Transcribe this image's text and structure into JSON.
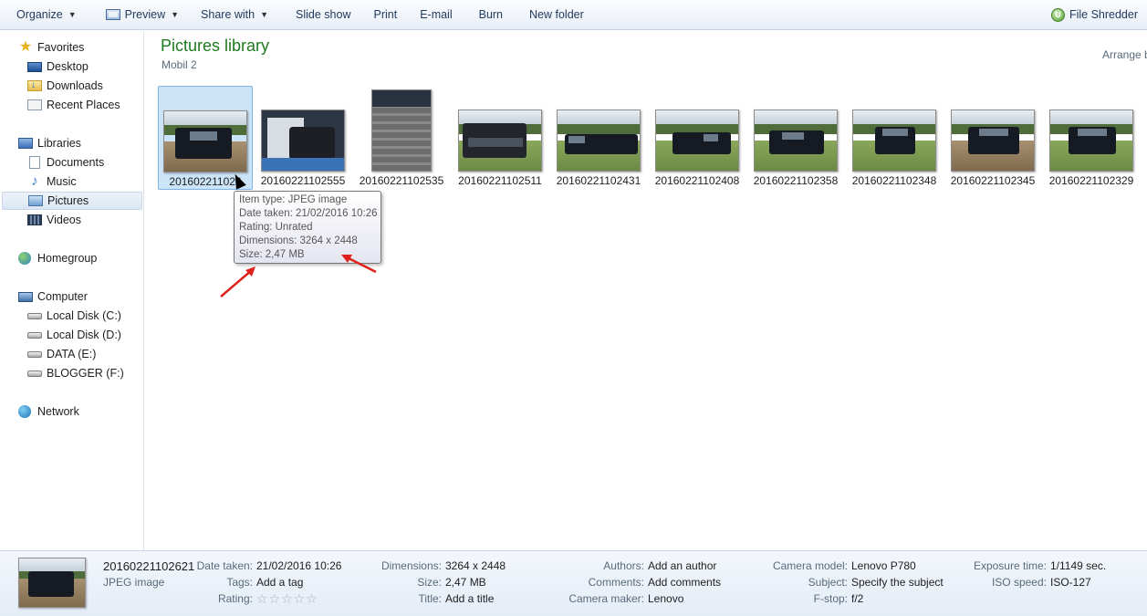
{
  "toolbar": {
    "organize": "Organize",
    "preview": "Preview",
    "share_with": "Share with",
    "slide_show": "Slide show",
    "print": "Print",
    "email": "E-mail",
    "burn": "Burn",
    "new_folder": "New folder",
    "file_shredder": "File Shredder",
    "file_shredder_icon_letter": "U"
  },
  "nav": {
    "favorites": "Favorites",
    "desktop": "Desktop",
    "downloads": "Downloads",
    "recent_places": "Recent Places",
    "libraries": "Libraries",
    "documents": "Documents",
    "music": "Music",
    "pictures": "Pictures",
    "videos": "Videos",
    "homegroup": "Homegroup",
    "computer": "Computer",
    "disk_c": "Local Disk (C:)",
    "disk_d": "Local Disk (D:)",
    "disk_e": "DATA (E:)",
    "disk_f": "BLOGGER (F:)",
    "network": "Network"
  },
  "header": {
    "title": "Pictures library",
    "subtitle": "Mobil 2",
    "arrange": "Arrange b"
  },
  "files": [
    {
      "name": "20160221102621",
      "label": "201602211026"
    },
    {
      "name": "20160221102555",
      "label": "20160221102555"
    },
    {
      "name": "20160221102535",
      "label": "20160221102535"
    },
    {
      "name": "20160221102511",
      "label": "20160221102511"
    },
    {
      "name": "20160221102431",
      "label": "20160221102431"
    },
    {
      "name": "20160221102408",
      "label": "20160221102408"
    },
    {
      "name": "20160221102358",
      "label": "20160221102358"
    },
    {
      "name": "20160221102348",
      "label": "20160221102348"
    },
    {
      "name": "20160221102345",
      "label": "20160221102345"
    },
    {
      "name": "20160221102329",
      "label": "20160221102329"
    }
  ],
  "tooltip": {
    "item_type": "Item type: JPEG image",
    "date_taken": "Date taken: 21/02/2016 10:26",
    "rating": "Rating: Unrated",
    "dimensions": "Dimensions: 3264 x 2448",
    "size": "Size: 2,47 MB"
  },
  "details": {
    "name": "20160221102621",
    "type": "JPEG image",
    "date_taken_label": "Date taken:",
    "date_taken": "21/02/2016 10:26",
    "tags_label": "Tags:",
    "tags": "Add a tag",
    "rating_label": "Rating:",
    "rating_stars": "☆☆☆☆☆",
    "dimensions_label": "Dimensions:",
    "dimensions": "3264 x 2448",
    "size_label": "Size:",
    "size": "2,47 MB",
    "title_label": "Title:",
    "title": "Add a title",
    "authors_label": "Authors:",
    "authors": "Add an author",
    "comments_label": "Comments:",
    "comments": "Add comments",
    "camera_maker_label": "Camera maker:",
    "camera_maker": "Lenovo",
    "camera_model_label": "Camera model:",
    "camera_model": "Lenovo P780",
    "subject_label": "Subject:",
    "subject": "Specify the subject",
    "fstop_label": "F-stop:",
    "fstop": "f/2",
    "exposure_label": "Exposure time:",
    "exposure": "1/1149 sec.",
    "iso_label": "ISO speed:",
    "iso": "ISO-127"
  },
  "colors": {
    "title_green": "#1e7a1e",
    "annotation_arrow": "#e0201b",
    "selection": "#cce4f7"
  }
}
